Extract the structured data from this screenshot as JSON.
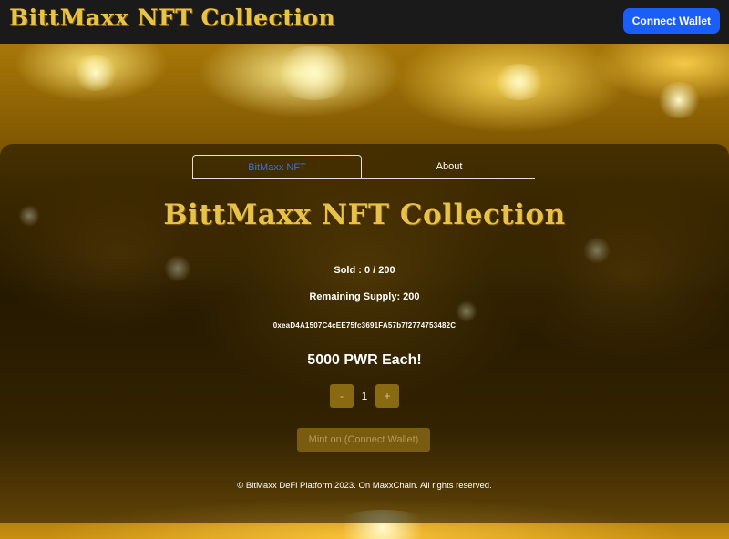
{
  "header": {
    "logo_text": "BittMaxx NFT Collection",
    "connect_button_label": "Connect Wallet"
  },
  "tabs": [
    {
      "label": "BitMaxx NFT",
      "active": true
    },
    {
      "label": "About",
      "active": false
    }
  ],
  "main": {
    "title": "BittMaxx NFT Collection",
    "sold_text": "Sold : 0 / 200",
    "remaining_text": "Remaining Supply: 200",
    "contract_address": "0xeaD4A1507C4cEE75fc3691FA57b7f2774753482C",
    "price_text": "5000 PWR Each!",
    "quantity": {
      "decrement_label": "-",
      "value": "1",
      "increment_label": "+"
    },
    "mint_button_label": "Mint on (Connect Wallet)"
  },
  "footer": {
    "copyright": "© BitMaxx DeFi Platform 2023. On MaxxChain. All rights reserved."
  },
  "colors": {
    "accent_blue": "#1b5ef7",
    "gold": "#e6c24a",
    "header_bg": "#1a1a1a"
  }
}
